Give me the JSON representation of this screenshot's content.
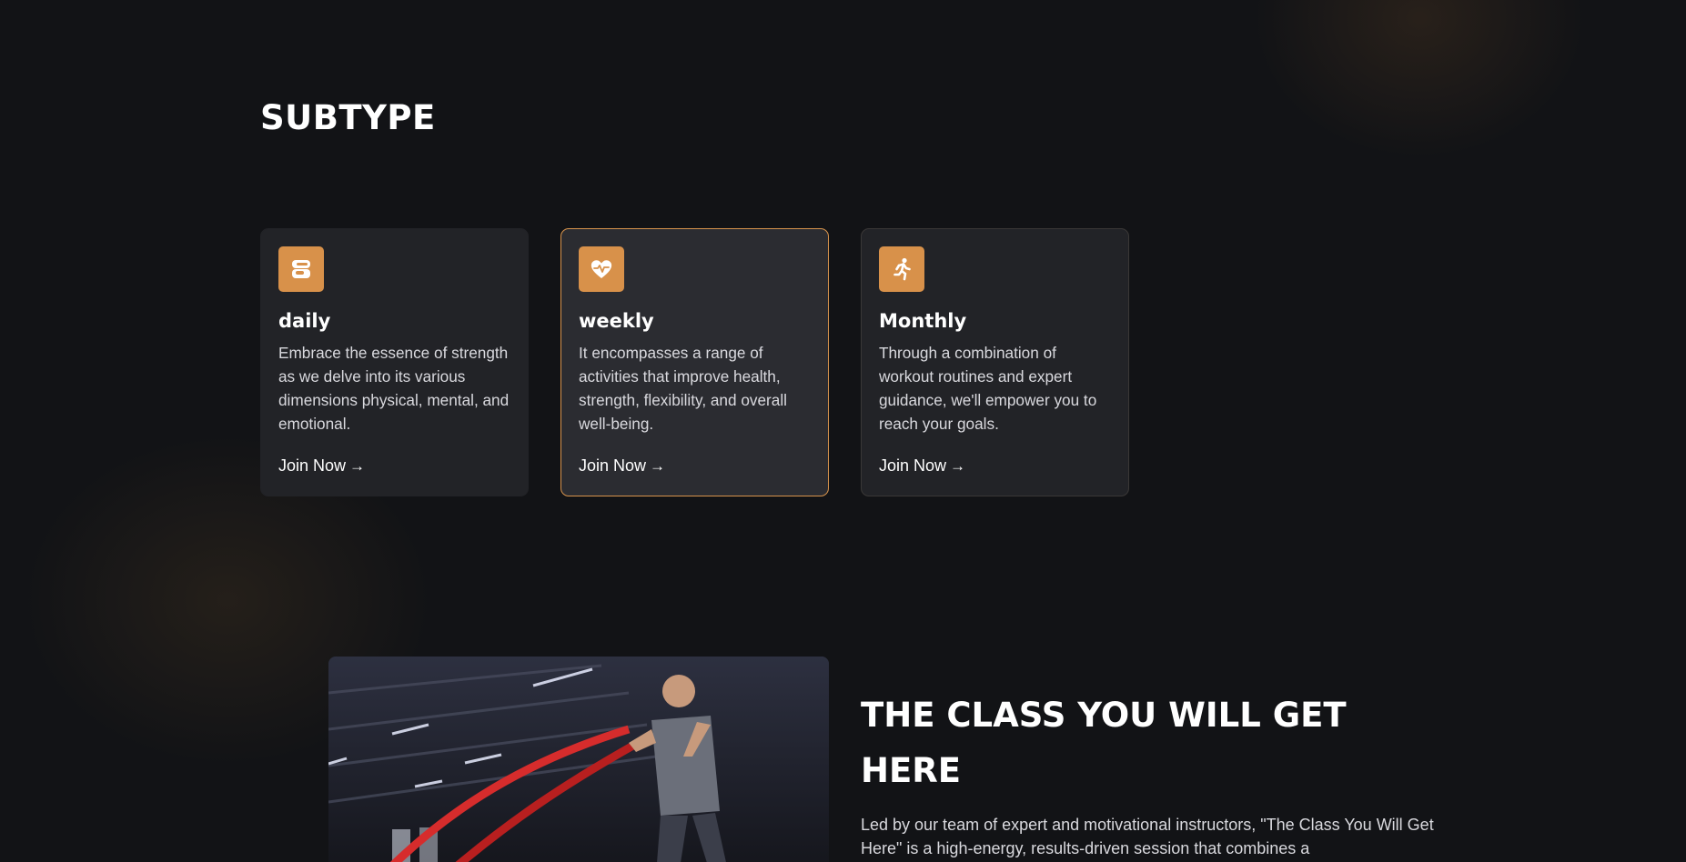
{
  "subtype": {
    "title": "SUBTYPE",
    "cards": [
      {
        "title": "daily",
        "text": "Embrace the essence of strength as we delve into its various dimensions physical, mental, and emotional.",
        "link": "Join Now",
        "icon": "kettlebell-icon"
      },
      {
        "title": "weekly",
        "text": "It encompasses a range of activities that improve health, strength, flexibility, and overall well-being.",
        "link": "Join Now",
        "icon": "heart-pulse-icon"
      },
      {
        "title": "Monthly",
        "text": "Through a combination of workout routines and expert guidance, we'll empower you to reach your goals.",
        "link": "Join Now",
        "icon": "running-icon"
      }
    ]
  },
  "classes": {
    "title": "THE CLASS YOU WILL GET HERE",
    "description": "Led by our team of expert and motivational instructors, \"The Class You Will Get Here\" is a high-energy, results-driven session that combines a",
    "image_alt": "man training with battle ropes in gym"
  },
  "colors": {
    "background": "#121316",
    "card": "#222327",
    "accent": "#d8914a",
    "text": "#ffffff",
    "muted_text": "#d9d9de"
  }
}
